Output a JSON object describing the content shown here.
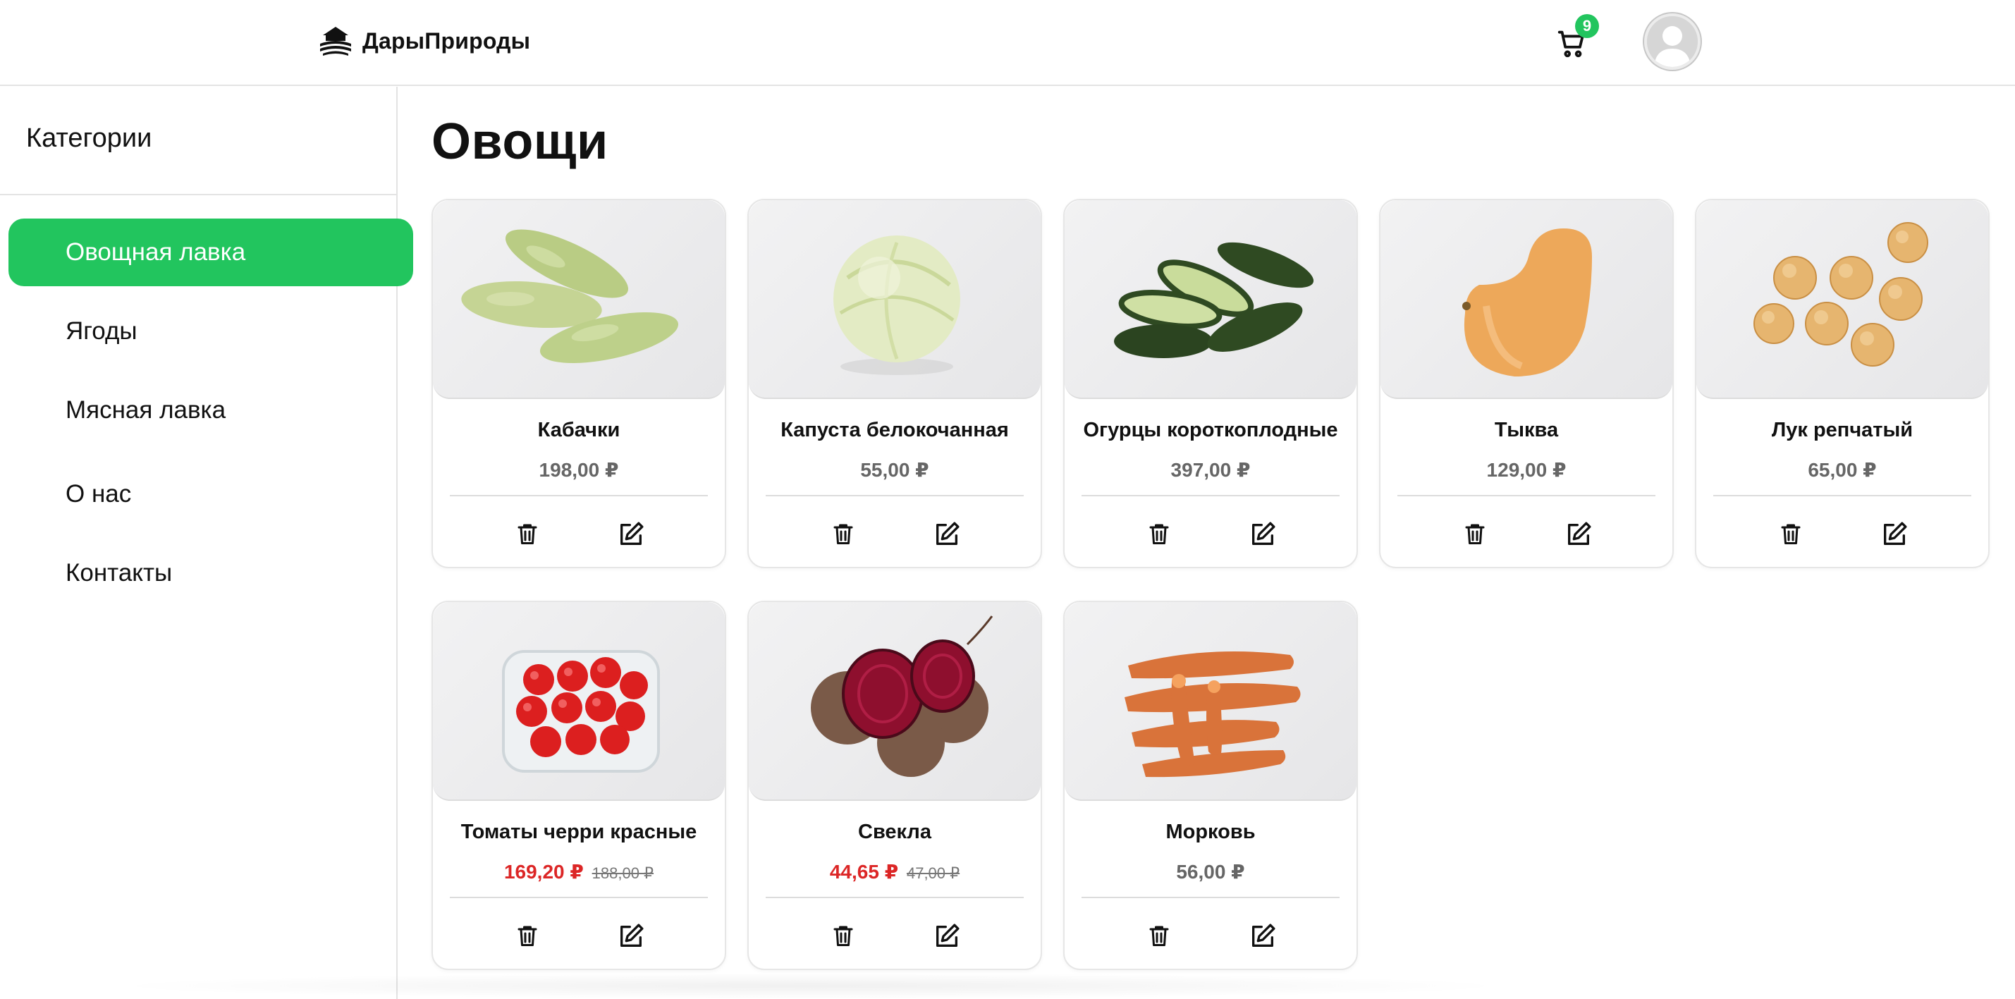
{
  "header": {
    "brand": "ДарыПрироды",
    "cart_count": "9",
    "icons": {
      "logo": "brand-logo-icon",
      "cart": "cart-icon",
      "avatar": "user-avatar"
    }
  },
  "sidebar": {
    "title": "Категории",
    "items": [
      {
        "label": "Овощная лавка",
        "active": true
      },
      {
        "label": "Ягоды",
        "active": false
      },
      {
        "label": "Мясная лавка",
        "active": false
      },
      {
        "label": "О нас",
        "active": false
      },
      {
        "label": "Контакты",
        "active": false
      }
    ]
  },
  "main": {
    "title": "Овощи",
    "products": [
      {
        "name": "Кабачки",
        "price": "198,00 ₽",
        "image": "zucchini"
      },
      {
        "name": "Капуста белокочанная",
        "price": "55,00 ₽",
        "image": "cabbage"
      },
      {
        "name": "Огурцы короткоплодные",
        "price": "397,00 ₽",
        "image": "cucumbers"
      },
      {
        "name": "Тыква",
        "price": "129,00 ₽",
        "image": "pumpkin"
      },
      {
        "name": "Лук репчатый",
        "price": "65,00 ₽",
        "image": "onions"
      },
      {
        "name": "Томаты черри красные",
        "price": "169,20 ₽",
        "old_price": "188,00 ₽",
        "image": "cherry-tomatoes"
      },
      {
        "name": "Свекла",
        "price": "44,65 ₽",
        "old_price": "47,00 ₽",
        "image": "beets"
      },
      {
        "name": "Морковь",
        "price": "56,00 ₽",
        "image": "carrots"
      }
    ],
    "action_icons": {
      "delete": "trash-icon",
      "edit": "edit-icon"
    }
  },
  "colors": {
    "accent": "#22c55e",
    "sale": "#dc2626",
    "price": "#666666",
    "border": "#e3e3e3"
  }
}
